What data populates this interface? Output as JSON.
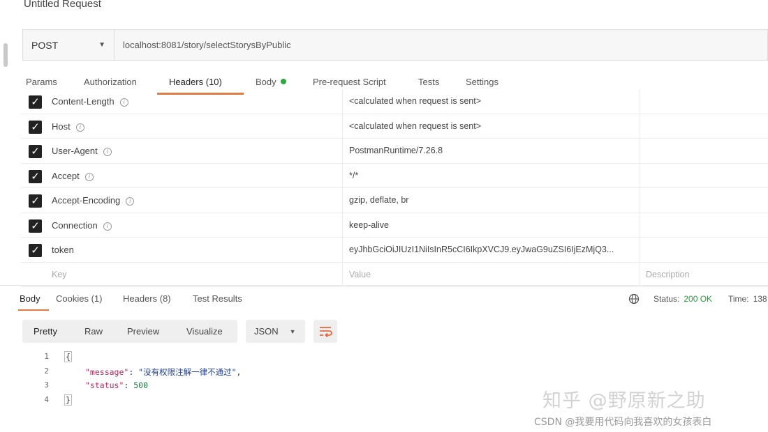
{
  "request": {
    "title": "Untitled Request",
    "method": "POST",
    "url": "localhost:8081/story/selectStorysByPublic"
  },
  "request_tabs": [
    {
      "label": "Params"
    },
    {
      "label": "Authorization"
    },
    {
      "label": "Headers (10)"
    },
    {
      "label": "Body"
    },
    {
      "label": "Pre-request Script"
    },
    {
      "label": "Tests"
    },
    {
      "label": "Settings"
    }
  ],
  "headers": [
    {
      "key": "Content-Length",
      "value": "<calculated when request is sent>"
    },
    {
      "key": "Host",
      "value": "<calculated when request is sent>"
    },
    {
      "key": "User-Agent",
      "value": "PostmanRuntime/7.26.8"
    },
    {
      "key": "Accept",
      "value": "*/*"
    },
    {
      "key": "Accept-Encoding",
      "value": "gzip, deflate, br"
    },
    {
      "key": "Connection",
      "value": "keep-alive"
    },
    {
      "key": "token",
      "value": "eyJhbGciOiJIUzI1NiIsInR5cCI6IkpXVCJ9.eyJwaG9uZSI6IjEzMjQ3..."
    }
  ],
  "headers_placeholder": {
    "key": "Key",
    "value": "Value",
    "description": "Description"
  },
  "response_tabs": [
    {
      "label": "Body"
    },
    {
      "label": "Cookies (1)"
    },
    {
      "label": "Headers (8)"
    },
    {
      "label": "Test Results"
    }
  ],
  "response_status": {
    "label": "Status:",
    "value": "200 OK",
    "time_label": "Time:",
    "time_value": "138"
  },
  "view_modes": [
    {
      "label": "Pretty"
    },
    {
      "label": "Raw"
    },
    {
      "label": "Preview"
    },
    {
      "label": "Visualize"
    }
  ],
  "format": {
    "label": "JSON"
  },
  "code": {
    "line_numbers": [
      "1",
      "2",
      "3",
      "4"
    ],
    "open_brace": "{",
    "message_key": "\"message\"",
    "message_value": "\"没有权限注解一律不通过\"",
    "status_key": "\"status\"",
    "status_value": "500",
    "close_brace": "}"
  },
  "watermark": {
    "primary": "知乎 @野原新之助",
    "secondary": "CSDN @我要用代码向我喜欢的女孩表白"
  }
}
